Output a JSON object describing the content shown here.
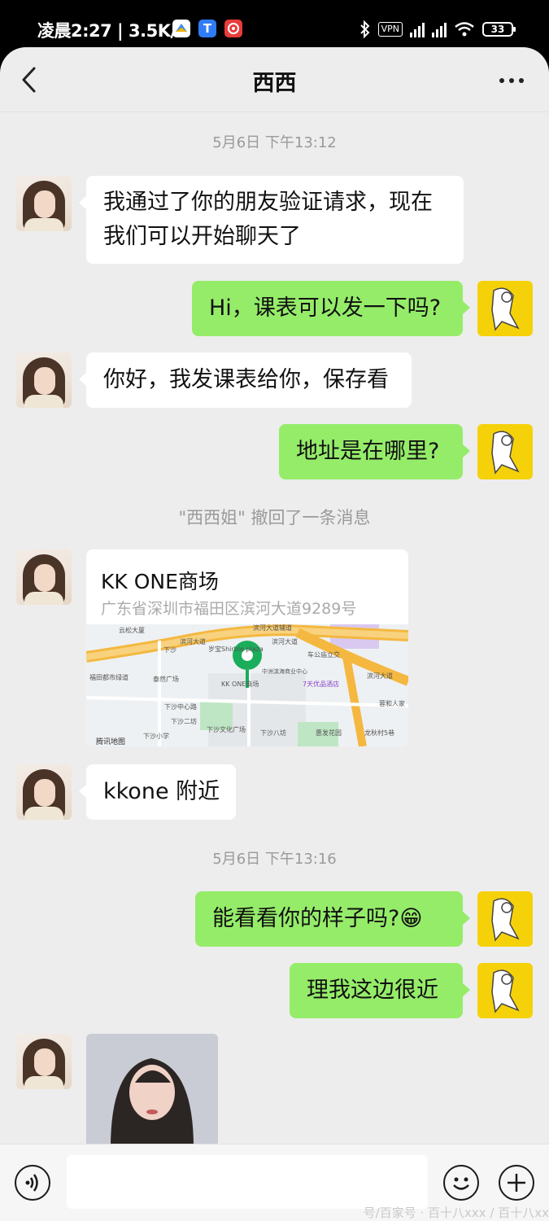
{
  "status_bar": {
    "time_speed": "凌晨2:27 | 3.5K/s",
    "vpn": "VPN",
    "battery": "33"
  },
  "header": {
    "title": "西西"
  },
  "messages": {
    "ts1": "5月6日 下午13:12",
    "m1": "我通过了你的朋友验证请求，现在",
    "m1b": "我们可以开始聊天了",
    "m2": "Hi，课表可以发一下吗?",
    "m3": "你好，我发课表给你，保存看",
    "m4": "地址是在哪里?",
    "notice": "\"西西姐\" 撤回了一条消息",
    "location": {
      "name": "KK ONE商场",
      "address": "广东省深圳市福田区滨河大道9289号",
      "map_labels": [
        "云松大厦",
        "滨河大道辅道",
        "滨河大道",
        "滨河大道",
        "下沙",
        "岁宝Shirble plaza",
        "中洲滨海商业中心",
        "车公庙立交",
        "福田都市绿道",
        "泰然广场",
        "KK ONE商场",
        "7天优品酒店",
        "滨河大道",
        "下沙二坊",
        "下沙文化广场",
        "下沙八坊",
        "惠发花园",
        "龙秋村5巷",
        "下沙小学",
        "下沙中心路",
        "蓉和人家",
        "腾讯地图"
      ]
    },
    "m5": "kkone 附近",
    "ts2": "5月6日 下午13:16",
    "m6": "能看看你的样子吗?😁",
    "m7": "理我这边很近"
  },
  "input": {
    "placeholder": ""
  },
  "watermark": "号/百家号 · 百十八xxx / 百十八xx"
}
